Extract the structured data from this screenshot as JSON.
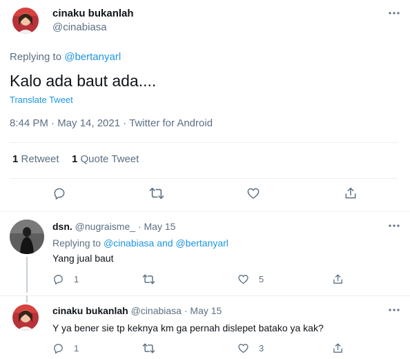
{
  "main_tweet": {
    "display_name": "cinaku bukanlah",
    "handle": "@cinabiasa",
    "replying_prefix": "Replying to",
    "replying_to": "@bertanyarl",
    "text": "Kalo ada baut ada....",
    "translate": "Translate Tweet",
    "timestamp": "8:44 PM · May 14, 2021 · Twitter for Android",
    "retweets_count": "1",
    "retweets_label": "Retweet",
    "quotes_count": "1",
    "quotes_label": "Quote Tweet"
  },
  "replies": [
    {
      "display_name": "dsn.",
      "handle": "@nugraisme_",
      "separator": "·",
      "date": "May 15",
      "replying_prefix": "Replying to",
      "replying_to_1": "@cinabiasa",
      "replying_and": "and",
      "replying_to_2": "@bertanyarl",
      "text": "Yang jual baut",
      "reply_count": "1",
      "retweet_count": "",
      "like_count": "5"
    },
    {
      "display_name": "cinaku bukanlah",
      "handle": "@cinabiasa",
      "separator": "·",
      "date": "May 15",
      "text": "Y ya bener sie tp keknya km ga pernah dislepet batako ya kak?",
      "reply_count": "1",
      "retweet_count": "",
      "like_count": "3"
    }
  ],
  "colors": {
    "text": "#0f1419",
    "muted": "#5b7083",
    "link": "#1b95e0",
    "divider": "#ebeef0"
  }
}
